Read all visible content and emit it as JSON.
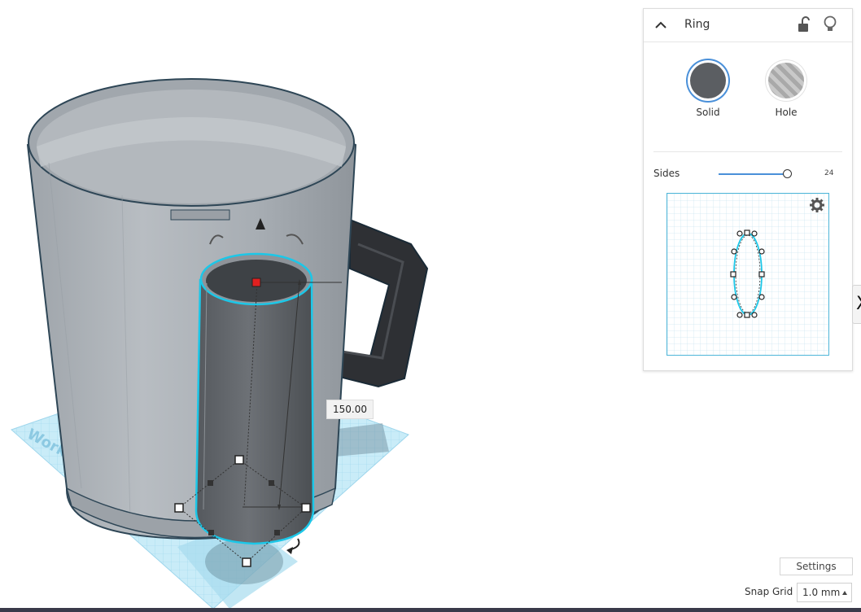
{
  "shape_panel": {
    "title": "Ring",
    "modes": [
      {
        "label": "Solid",
        "selected": true
      },
      {
        "label": "Hole",
        "selected": false
      }
    ],
    "sides": {
      "label": "Sides",
      "value": "24"
    },
    "icons": {
      "collapse": "chevron-up-icon",
      "lock": "unlock-icon",
      "bulb": "lightbulb-icon",
      "preview_settings": "gear-icon"
    }
  },
  "viewport": {
    "dimension_label": "150.00",
    "workplane_text": "Workpl",
    "edge_tab_text": "X"
  },
  "bottom_controls": {
    "settings_label": "Settings",
    "snap_grid_label": "Snap Grid",
    "snap_grid_value": "1.0 mm"
  },
  "colors": {
    "selection_outline": "#1cc7e8",
    "mug": "#a9afb5",
    "handle": "#2d2f33",
    "workplane": "#bfe6f4",
    "panel_accent": "#4a90d9"
  }
}
